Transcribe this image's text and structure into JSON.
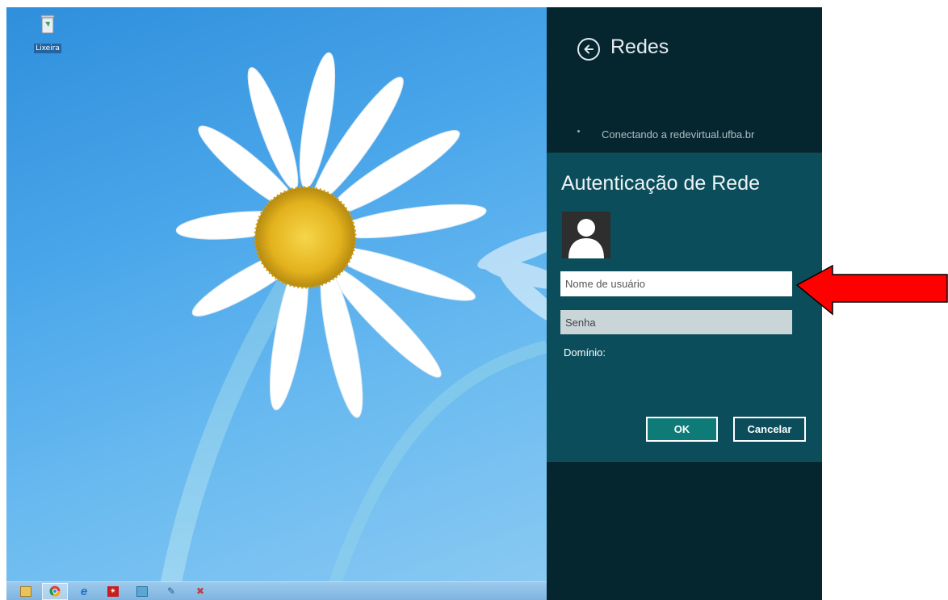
{
  "desktop": {
    "icons": [
      {
        "label": "Lixeira",
        "icon": "recycle-bin-icon"
      }
    ]
  },
  "taskbar": {
    "items": [
      {
        "icon": "file-explorer-icon",
        "active": false
      },
      {
        "icon": "chrome-icon",
        "active": true
      },
      {
        "icon": "internet-explorer-icon",
        "active": false
      },
      {
        "icon": "acrobat-reader-icon",
        "active": false
      },
      {
        "icon": "monitor-icon",
        "active": false
      },
      {
        "icon": "paint-icon",
        "active": false
      },
      {
        "icon": "network-icon",
        "active": false
      }
    ]
  },
  "charm": {
    "title": "Redes",
    "status": "Conectando a redevirtual.ufba.br",
    "auth": {
      "title": "Autenticação de Rede",
      "username_placeholder": "Nome de usuário",
      "password_placeholder": "Senha",
      "domain_label": "Domínio:",
      "ok_label": "OK",
      "cancel_label": "Cancelar"
    }
  },
  "colors": {
    "charm_bg": "#06262f",
    "auth_bg": "#0c4d5c",
    "ok_bg": "#0e7b78",
    "arrow": "#ff0000"
  }
}
